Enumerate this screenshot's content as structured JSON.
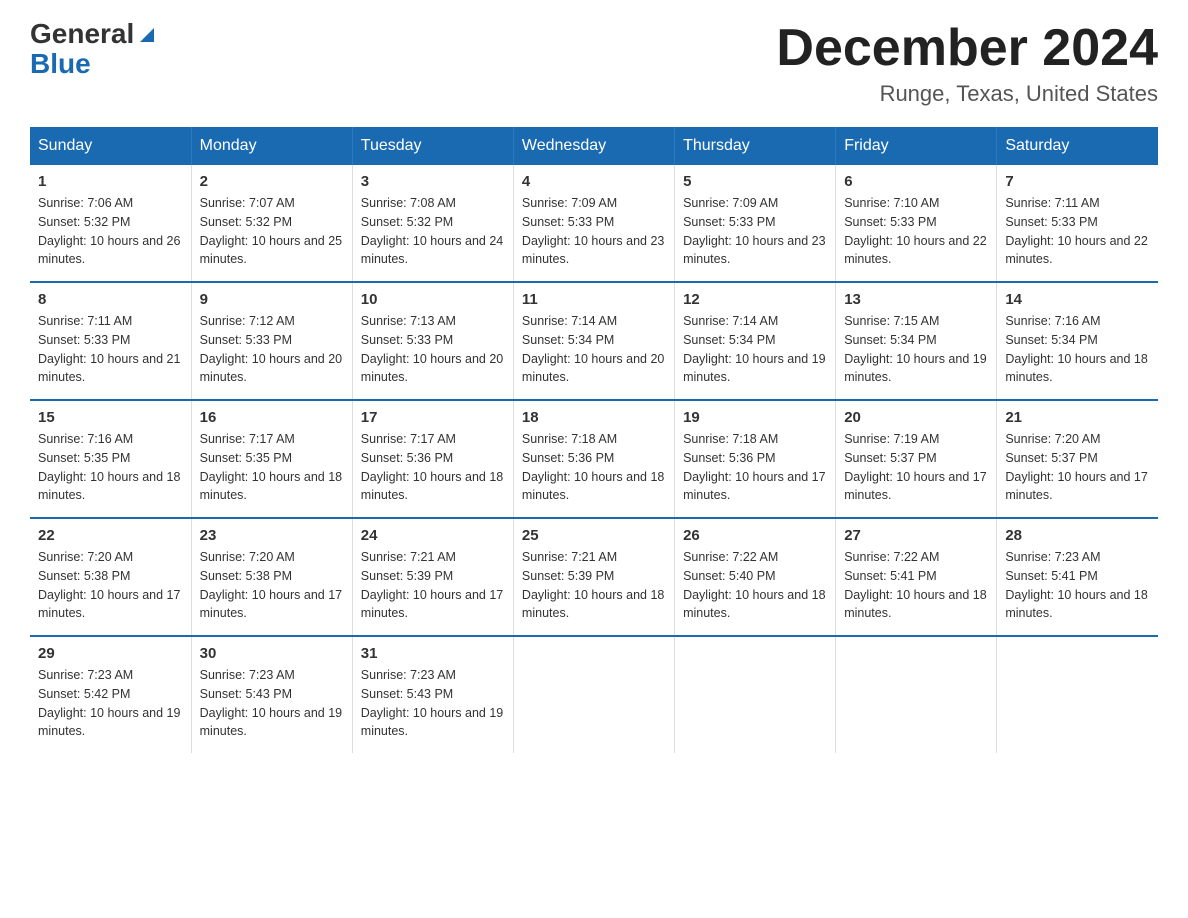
{
  "logo": {
    "general": "General",
    "blue": "Blue"
  },
  "title": "December 2024",
  "location": "Runge, Texas, United States",
  "headers": [
    "Sunday",
    "Monday",
    "Tuesday",
    "Wednesday",
    "Thursday",
    "Friday",
    "Saturday"
  ],
  "weeks": [
    [
      {
        "day": "1",
        "sunrise": "7:06 AM",
        "sunset": "5:32 PM",
        "daylight": "10 hours and 26 minutes."
      },
      {
        "day": "2",
        "sunrise": "7:07 AM",
        "sunset": "5:32 PM",
        "daylight": "10 hours and 25 minutes."
      },
      {
        "day": "3",
        "sunrise": "7:08 AM",
        "sunset": "5:32 PM",
        "daylight": "10 hours and 24 minutes."
      },
      {
        "day": "4",
        "sunrise": "7:09 AM",
        "sunset": "5:33 PM",
        "daylight": "10 hours and 23 minutes."
      },
      {
        "day": "5",
        "sunrise": "7:09 AM",
        "sunset": "5:33 PM",
        "daylight": "10 hours and 23 minutes."
      },
      {
        "day": "6",
        "sunrise": "7:10 AM",
        "sunset": "5:33 PM",
        "daylight": "10 hours and 22 minutes."
      },
      {
        "day": "7",
        "sunrise": "7:11 AM",
        "sunset": "5:33 PM",
        "daylight": "10 hours and 22 minutes."
      }
    ],
    [
      {
        "day": "8",
        "sunrise": "7:11 AM",
        "sunset": "5:33 PM",
        "daylight": "10 hours and 21 minutes."
      },
      {
        "day": "9",
        "sunrise": "7:12 AM",
        "sunset": "5:33 PM",
        "daylight": "10 hours and 20 minutes."
      },
      {
        "day": "10",
        "sunrise": "7:13 AM",
        "sunset": "5:33 PM",
        "daylight": "10 hours and 20 minutes."
      },
      {
        "day": "11",
        "sunrise": "7:14 AM",
        "sunset": "5:34 PM",
        "daylight": "10 hours and 20 minutes."
      },
      {
        "day": "12",
        "sunrise": "7:14 AM",
        "sunset": "5:34 PM",
        "daylight": "10 hours and 19 minutes."
      },
      {
        "day": "13",
        "sunrise": "7:15 AM",
        "sunset": "5:34 PM",
        "daylight": "10 hours and 19 minutes."
      },
      {
        "day": "14",
        "sunrise": "7:16 AM",
        "sunset": "5:34 PM",
        "daylight": "10 hours and 18 minutes."
      }
    ],
    [
      {
        "day": "15",
        "sunrise": "7:16 AM",
        "sunset": "5:35 PM",
        "daylight": "10 hours and 18 minutes."
      },
      {
        "day": "16",
        "sunrise": "7:17 AM",
        "sunset": "5:35 PM",
        "daylight": "10 hours and 18 minutes."
      },
      {
        "day": "17",
        "sunrise": "7:17 AM",
        "sunset": "5:36 PM",
        "daylight": "10 hours and 18 minutes."
      },
      {
        "day": "18",
        "sunrise": "7:18 AM",
        "sunset": "5:36 PM",
        "daylight": "10 hours and 18 minutes."
      },
      {
        "day": "19",
        "sunrise": "7:18 AM",
        "sunset": "5:36 PM",
        "daylight": "10 hours and 17 minutes."
      },
      {
        "day": "20",
        "sunrise": "7:19 AM",
        "sunset": "5:37 PM",
        "daylight": "10 hours and 17 minutes."
      },
      {
        "day": "21",
        "sunrise": "7:20 AM",
        "sunset": "5:37 PM",
        "daylight": "10 hours and 17 minutes."
      }
    ],
    [
      {
        "day": "22",
        "sunrise": "7:20 AM",
        "sunset": "5:38 PM",
        "daylight": "10 hours and 17 minutes."
      },
      {
        "day": "23",
        "sunrise": "7:20 AM",
        "sunset": "5:38 PM",
        "daylight": "10 hours and 17 minutes."
      },
      {
        "day": "24",
        "sunrise": "7:21 AM",
        "sunset": "5:39 PM",
        "daylight": "10 hours and 17 minutes."
      },
      {
        "day": "25",
        "sunrise": "7:21 AM",
        "sunset": "5:39 PM",
        "daylight": "10 hours and 18 minutes."
      },
      {
        "day": "26",
        "sunrise": "7:22 AM",
        "sunset": "5:40 PM",
        "daylight": "10 hours and 18 minutes."
      },
      {
        "day": "27",
        "sunrise": "7:22 AM",
        "sunset": "5:41 PM",
        "daylight": "10 hours and 18 minutes."
      },
      {
        "day": "28",
        "sunrise": "7:23 AM",
        "sunset": "5:41 PM",
        "daylight": "10 hours and 18 minutes."
      }
    ],
    [
      {
        "day": "29",
        "sunrise": "7:23 AM",
        "sunset": "5:42 PM",
        "daylight": "10 hours and 19 minutes."
      },
      {
        "day": "30",
        "sunrise": "7:23 AM",
        "sunset": "5:43 PM",
        "daylight": "10 hours and 19 minutes."
      },
      {
        "day": "31",
        "sunrise": "7:23 AM",
        "sunset": "5:43 PM",
        "daylight": "10 hours and 19 minutes."
      },
      null,
      null,
      null,
      null
    ]
  ],
  "labels": {
    "sunrise_prefix": "Sunrise: ",
    "sunset_prefix": "Sunset: ",
    "daylight_prefix": "Daylight: "
  }
}
